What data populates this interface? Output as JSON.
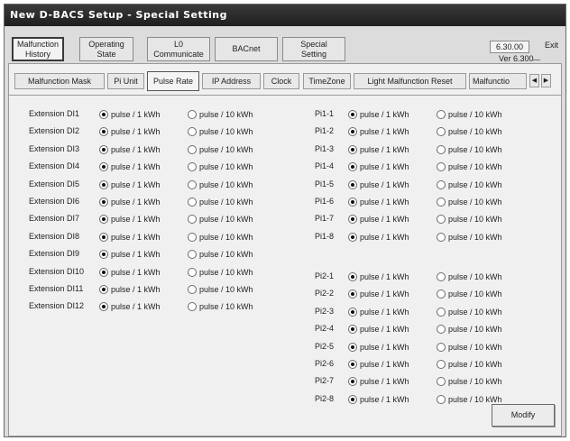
{
  "window": {
    "title": "New D-BACS Setup - Special Setting"
  },
  "main_buttons": [
    {
      "label": "Malfunction\nHistory"
    },
    {
      "label": "Operating\nState"
    },
    {
      "label": "L0\nCommunicate"
    },
    {
      "label": "BACnet"
    },
    {
      "label": "Special\nSetting"
    }
  ],
  "version": {
    "value": "6.30.00",
    "label": "Ver 6.300"
  },
  "exit_label": "Exit",
  "tabs": [
    {
      "label": "Malfunction Mask"
    },
    {
      "label": "Pi Unit"
    },
    {
      "label": "Pulse Rate"
    },
    {
      "label": "IP Address"
    },
    {
      "label": "Clock"
    },
    {
      "label": "TimeZone"
    },
    {
      "label": "Light Malfunction Reset"
    },
    {
      "label": "Malfunctio"
    }
  ],
  "active_tab": "Pulse Rate",
  "option_labels": {
    "opt1": "pulse / 1 kWh",
    "opt2": "pulse / 10 kWh"
  },
  "extension_rows": [
    {
      "label": "Extension DI1",
      "selected": 1
    },
    {
      "label": "Extension DI2",
      "selected": 1
    },
    {
      "label": "Extension DI3",
      "selected": 1
    },
    {
      "label": "Extension DI4",
      "selected": 1
    },
    {
      "label": "Extension DI5",
      "selected": 1
    },
    {
      "label": "Extension DI6",
      "selected": 1
    },
    {
      "label": "Extension DI7",
      "selected": 1
    },
    {
      "label": "Extension DI8",
      "selected": 1
    },
    {
      "label": "Extension DI9",
      "selected": 1
    },
    {
      "label": "Extension DI10",
      "selected": 1
    },
    {
      "label": "Extension DI11",
      "selected": 1
    },
    {
      "label": "Extension DI12",
      "selected": 1
    }
  ],
  "pi1_rows": [
    {
      "label": "Pi1-1",
      "selected": 1
    },
    {
      "label": "Pi1-2",
      "selected": 1
    },
    {
      "label": "Pi1-3",
      "selected": 1
    },
    {
      "label": "Pi1-4",
      "selected": 1
    },
    {
      "label": "Pi1-5",
      "selected": 1
    },
    {
      "label": "Pi1-6",
      "selected": 1
    },
    {
      "label": "Pi1-7",
      "selected": 1
    },
    {
      "label": "Pi1-8",
      "selected": 1
    }
  ],
  "pi2_rows": [
    {
      "label": "Pi2-1",
      "selected": 1
    },
    {
      "label": "Pi2-2",
      "selected": 1
    },
    {
      "label": "Pi2-3",
      "selected": 1
    },
    {
      "label": "Pi2-4",
      "selected": 1
    },
    {
      "label": "Pi2-5",
      "selected": 1
    },
    {
      "label": "Pi2-6",
      "selected": 1
    },
    {
      "label": "Pi2-7",
      "selected": 1
    },
    {
      "label": "Pi2-8",
      "selected": 1
    }
  ],
  "modify_label": "Modify"
}
